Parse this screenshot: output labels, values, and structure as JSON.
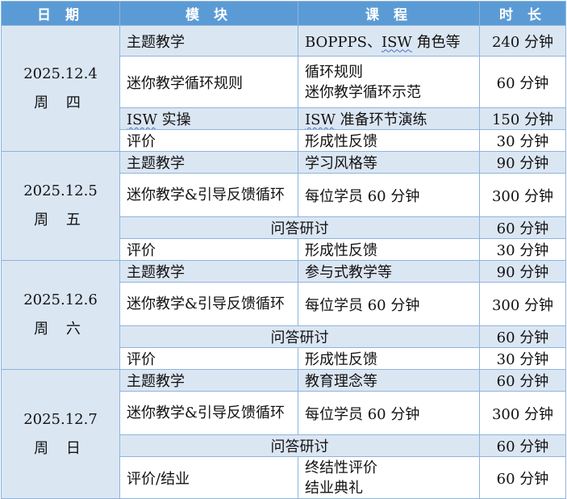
{
  "header": {
    "date": "日 期",
    "module": "模 块",
    "course": "课 程",
    "duration": "时 长"
  },
  "days": [
    {
      "date": "2025.12.4",
      "weekday": "周 四",
      "rows": [
        {
          "module": "主题教学",
          "course_prefix": "BOPPPS、",
          "course_mark": "ISW",
          "course_suffix": " 角色等",
          "duration": "240 分钟"
        },
        {
          "module": "迷你教学循环规则",
          "course_line1": "循环规则",
          "course_line2": "迷你教学循环示范",
          "duration": "60 分钟"
        },
        {
          "module_mark": "ISW",
          "module_suffix": " 实操",
          "course_mark": "ISW",
          "course_suffix": " 准备环节演练",
          "duration": "150 分钟"
        },
        {
          "module": "评价",
          "course": "形成性反馈",
          "duration": "30 分钟"
        }
      ]
    },
    {
      "date": "2025.12.5",
      "weekday": "周 五",
      "rows": [
        {
          "module": "主题教学",
          "course": "学习风格等",
          "duration": "90 分钟"
        },
        {
          "module": "迷你教学&引导反馈循环",
          "course": "每位学员 60 分钟",
          "duration": "300 分钟"
        },
        {
          "merged": "问答研讨",
          "duration": "60 分钟"
        },
        {
          "module": "评价",
          "course": "形成性反馈",
          "duration": "30 分钟"
        }
      ]
    },
    {
      "date": "2025.12.6",
      "weekday": "周 六",
      "rows": [
        {
          "module": "主题教学",
          "course": "参与式教学等",
          "duration": "90 分钟"
        },
        {
          "module": "迷你教学&引导反馈循环",
          "course": "每位学员 60 分钟",
          "duration": "300 分钟"
        },
        {
          "merged": "问答研讨",
          "duration": "60 分钟"
        },
        {
          "module": "评价",
          "course": "形成性反馈",
          "duration": "30 分钟"
        }
      ]
    },
    {
      "date": "2025.12.7",
      "weekday": "周 日",
      "rows": [
        {
          "module": "主题教学",
          "course": "教育理念等",
          "duration": "60 分钟"
        },
        {
          "module": "迷你教学&引导反馈循环",
          "course": "每位学员 60 分钟",
          "duration": "300 分钟"
        },
        {
          "merged": "问答研讨",
          "duration": "60 分钟"
        },
        {
          "module": "评价/结业",
          "course_line1": "终结性评价",
          "course_line2": "结业典礼",
          "duration": "60 分钟"
        }
      ]
    }
  ],
  "colors": {
    "header_bg": "#5b9bd5",
    "band_bg": "#dbe6f3",
    "border": "#8eb4dc",
    "squiggle": "#4472c4"
  }
}
